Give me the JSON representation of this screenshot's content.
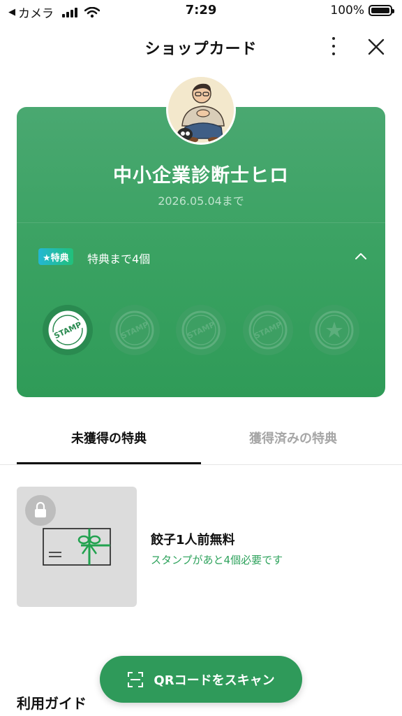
{
  "status_bar": {
    "back_app": "カメラ",
    "time": "7:29",
    "battery_percent": "100%",
    "battery_level": 1.0
  },
  "header": {
    "title": "ショップカード",
    "more_icon": "more-vertical-icon",
    "close_icon": "close-icon"
  },
  "card": {
    "shop_name": "中小企業診断士ヒロ",
    "expiry": "2026.05.04まで",
    "badge": "★特典",
    "stamps_until_reward": "特典まで4個",
    "stamps_total": 5,
    "stamps_collected": 1,
    "stamp_label": "STAMP",
    "colors": {
      "card": "#3aa262",
      "stamp_filled": "#2a8a50",
      "stamp_empty": "#3d9f63"
    }
  },
  "tabs": [
    {
      "label": "未獲得の特典",
      "active": true
    },
    {
      "label": "獲得済みの特典",
      "active": false
    }
  ],
  "reward": {
    "title": "餃子1人前無料",
    "subtitle": "スタンプがあと4個必要です",
    "locked": true
  },
  "guide": {
    "title": "利用ガイド"
  },
  "scan_button": {
    "label": "QRコードをスキャン",
    "icon": "qr-scan-icon"
  },
  "colors": {
    "accent": "#2f9a5a",
    "link_green": "#2fa35d"
  }
}
